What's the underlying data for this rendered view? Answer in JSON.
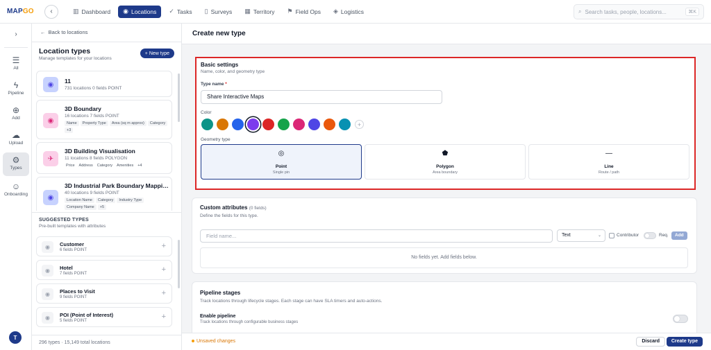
{
  "app": {
    "logo_main": "MAP",
    "logo_accent": "GO"
  },
  "nav": {
    "items": [
      {
        "label": "Dashboard",
        "icon": "dashboard-icon",
        "active": false
      },
      {
        "label": "Locations",
        "icon": "location-pin-icon",
        "active": true
      },
      {
        "label": "Tasks",
        "icon": "tasks-icon",
        "active": false
      },
      {
        "label": "Surveys",
        "icon": "survey-icon",
        "active": false
      },
      {
        "label": "Territory",
        "icon": "map-icon",
        "active": false
      },
      {
        "label": "Field Ops",
        "icon": "flag-icon",
        "active": false
      },
      {
        "label": "Logistics",
        "icon": "box-icon",
        "active": false
      }
    ],
    "search_placeholder": "Search tasks, people, locations...",
    "search_shortcut": "⌘K"
  },
  "rail": {
    "items": [
      {
        "label": "All",
        "icon": "list-icon"
      },
      {
        "label": "Pipeline",
        "icon": "lightning-icon"
      },
      {
        "label": "Add",
        "icon": "add-pin-icon"
      },
      {
        "label": "Upload",
        "icon": "upload-icon"
      },
      {
        "label": "Types",
        "icon": "gear-icon",
        "active": true
      },
      {
        "label": "Onboarding",
        "icon": "user-icon"
      }
    ],
    "avatar_initial": "T"
  },
  "panel": {
    "back_label": "Back to locations",
    "title": "Location types",
    "subtitle": "Manage templates for your locations",
    "new_type_label": "+ New type",
    "types": [
      {
        "name": "11",
        "meta": "731 locations   0 fields   POINT",
        "chips": [],
        "icon_bg": "#c7d2fe",
        "icon_color": "#4f46e5"
      },
      {
        "name": "3D Boundary",
        "meta": "16 locations   7 fields   POINT",
        "chips": [
          "Name",
          "Property Type",
          "Area (sq m approx)",
          "Category",
          "+3"
        ],
        "icon_bg": "#fbcfe8",
        "icon_color": "#db2777"
      },
      {
        "name": "3D Building Visualisation",
        "meta": "11 locations   8 fields   POLYGON",
        "chips": [
          "Price",
          "Address",
          "Category",
          "Amenities",
          "+4"
        ],
        "icon_bg": "#fbcfe8",
        "icon_color": "#db2777"
      },
      {
        "name": "3D Industrial Park Boundary Mapping...",
        "meta": "40 locations   9 fields   POINT",
        "chips": [
          "Location Name",
          "Category",
          "Industry Type",
          "Company Name",
          "+5"
        ],
        "icon_bg": "#c7d2fe",
        "icon_color": "#4f46e5"
      }
    ],
    "suggested_title": "SUGGESTED TYPES",
    "suggested_subtitle": "Pre-built templates with attributes",
    "suggested": [
      {
        "name": "Customer",
        "meta": "6 fields   POINT"
      },
      {
        "name": "Hotel",
        "meta": "7 fields   POINT"
      },
      {
        "name": "Places to Visit",
        "meta": "9 fields   POINT"
      },
      {
        "name": "POI (Point of Interest)",
        "meta": "5 fields   POINT"
      }
    ],
    "footer": "296 types · 15,149 total locations"
  },
  "main": {
    "title": "Create new type",
    "basic": {
      "title": "Basic settings",
      "subtitle": "Name, color, and geometry type",
      "type_name_label": "Type name",
      "type_name_value": "Share Interactive Maps",
      "color_label": "Color",
      "colors": [
        "#0d9488",
        "#d97706",
        "#2563eb",
        "#7c3aed",
        "#dc2626",
        "#16a34a",
        "#db2777",
        "#4f46e5",
        "#ea580c",
        "#0891b2"
      ],
      "selected_color_index": 3,
      "geometry_label": "Geometry type",
      "geometry": [
        {
          "name": "Point",
          "desc": "Single pin",
          "icon": "pin-icon",
          "selected": true
        },
        {
          "name": "Polygon",
          "desc": "Area boundary",
          "icon": "pentagon-icon",
          "selected": false
        },
        {
          "name": "Line",
          "desc": "Route / path",
          "icon": "line-icon",
          "selected": false
        }
      ]
    },
    "attributes": {
      "title": "Custom attributes",
      "count": "(0 fields)",
      "subtitle": "Define the fields for this type.",
      "field_placeholder": "Field name...",
      "type_value": "Text",
      "contributor_label": "Contributor",
      "req_label": "Req.",
      "add_label": "Add",
      "empty_text": "No fields yet. Add fields below."
    },
    "pipeline": {
      "title": "Pipeline stages",
      "subtitle": "Track locations through lifecycle stages. Each stage can have SLA timers and auto-actions.",
      "enable_label": "Enable pipeline",
      "enable_sub": "Track locations through configurable business stages"
    }
  },
  "footer": {
    "unsaved": "Unsaved changes",
    "discard": "Discard",
    "create": "Create type"
  }
}
